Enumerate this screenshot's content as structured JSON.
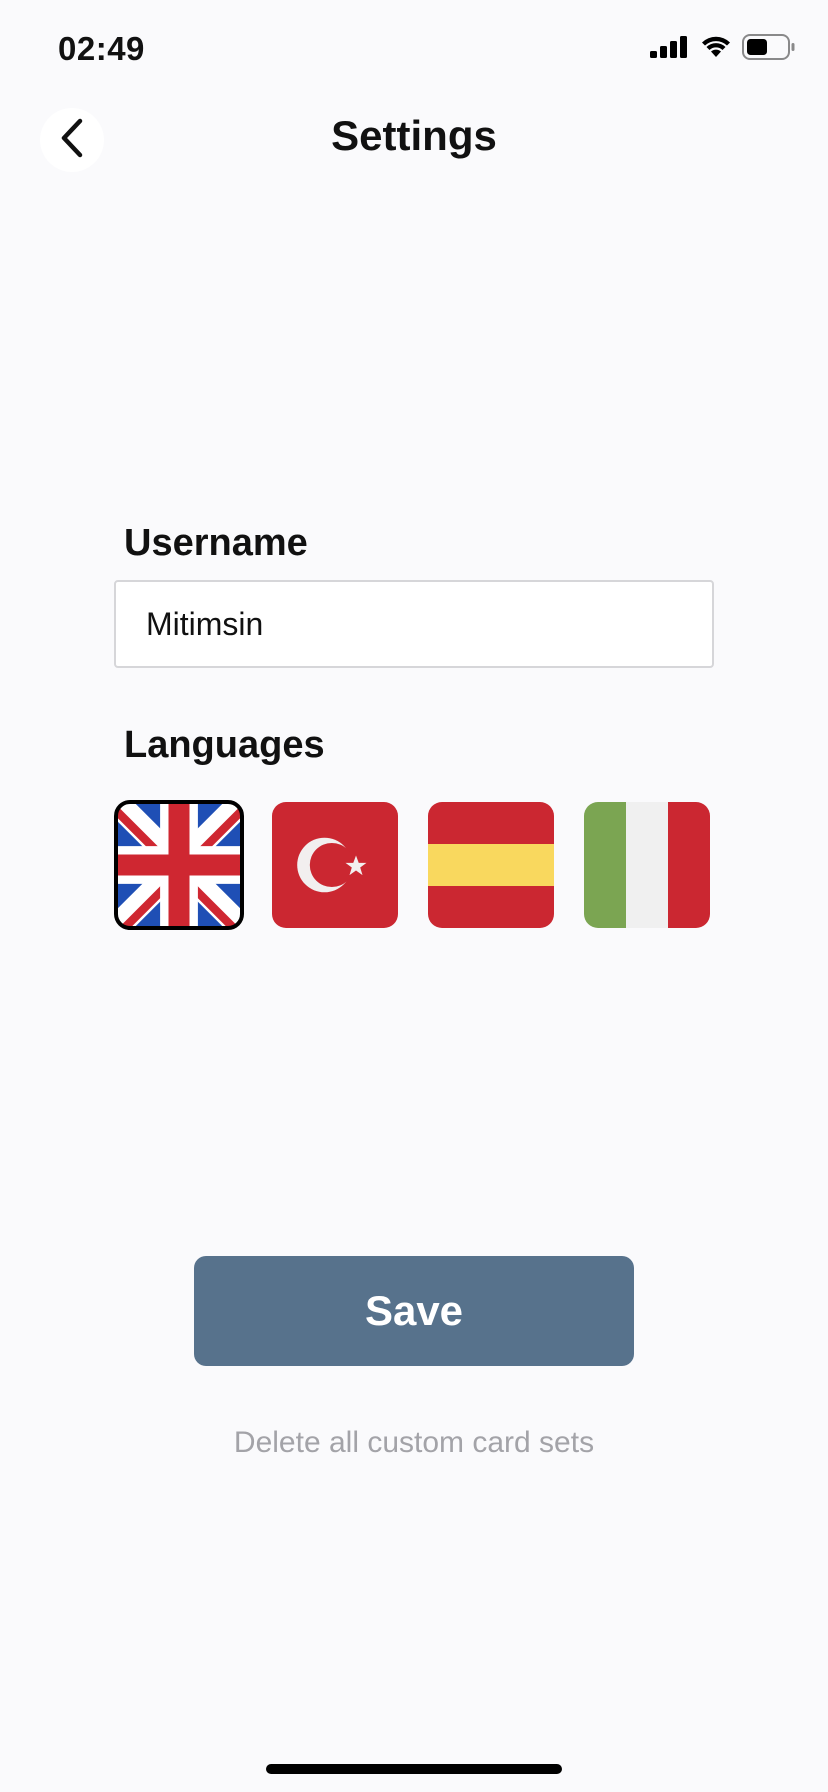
{
  "status_bar": {
    "time": "02:49",
    "icons": [
      "signal-icon",
      "wifi-icon",
      "battery-icon"
    ]
  },
  "header": {
    "title": "Settings",
    "back_icon": "chevron-left-icon"
  },
  "form": {
    "username_label": "Username",
    "username_value": "Mitimsin",
    "languages_label": "Languages",
    "languages": [
      {
        "name": "flag-uk",
        "selected": true
      },
      {
        "name": "flag-turkey",
        "selected": false
      },
      {
        "name": "flag-spain",
        "selected": false
      },
      {
        "name": "flag-italy",
        "selected": false
      }
    ]
  },
  "actions": {
    "save_label": "Save",
    "delete_label": "Delete all custom card sets"
  },
  "colors": {
    "background": "#fafafc",
    "save_button": "#57728c",
    "delete_text": "#a3a3a8",
    "selected_outline": "#000000"
  }
}
